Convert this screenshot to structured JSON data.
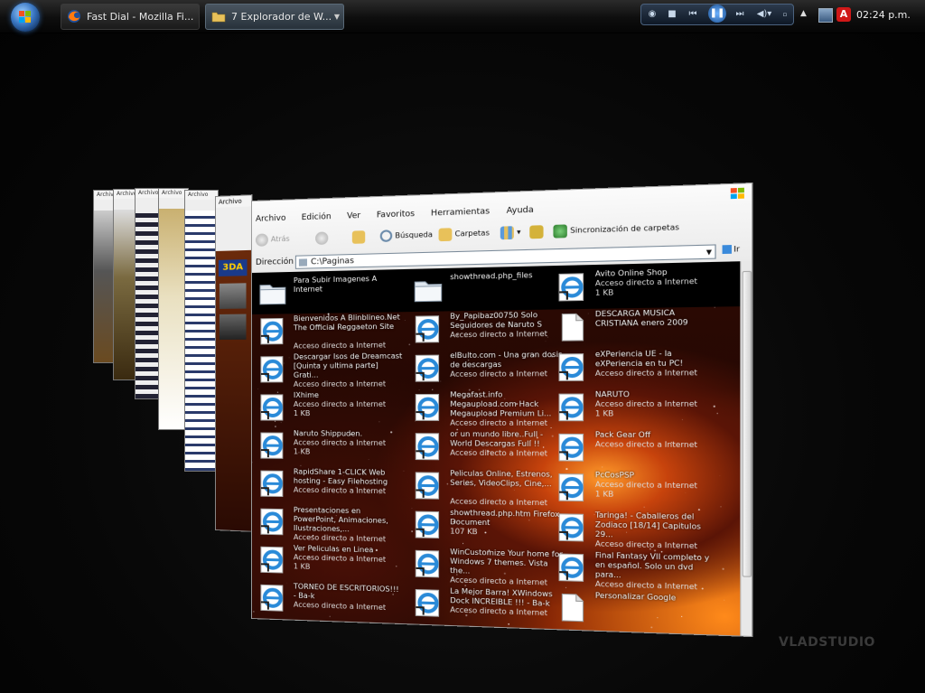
{
  "taskbar": {
    "tasks": [
      {
        "label": "Fast Dial - Mozilla Fi...",
        "icon": "firefox-icon"
      },
      {
        "label": "7  Explorador de W...",
        "icon": "folder-icon"
      }
    ],
    "clock": "02:24 p.m."
  },
  "explorer": {
    "menu": [
      "Archivo",
      "Edición",
      "Ver",
      "Favoritos",
      "Herramientas",
      "Ayuda"
    ],
    "toolbar": {
      "back": "Atrás",
      "search": "Búsqueda",
      "folders": "Carpetas",
      "sync": "Sincronización de carpetas"
    },
    "address_label": "Dirección",
    "address_value": "C:\\Paginas",
    "go_label": "Ir",
    "files": [
      {
        "name": "Para Subir Imagenes A Internet",
        "detail": "",
        "size": "",
        "icon": "folder"
      },
      {
        "name": "showthread.php_files",
        "detail": "",
        "size": "",
        "icon": "folder"
      },
      {
        "name": "Avito Online Shop",
        "detail": "Acceso directo a Internet",
        "size": "1 KB",
        "icon": "ie"
      },
      {
        "name": "Bienvenidos A Blinblineo.Net The Official Reggaeton Site",
        "detail": "Acceso directo a Internet",
        "size": "",
        "icon": "ie"
      },
      {
        "name": "By_Papibaz00750 Solo Seguidores de Naruto S",
        "detail": "Acceso directo a Internet",
        "size": "",
        "icon": "ie"
      },
      {
        "name": "DESCARGA MUSICA CRISTIANA enero 2009",
        "detail": "",
        "size": "",
        "icon": "doc"
      },
      {
        "name": "Descargar Isos de Dreamcast [Quinta y ultima parte] Grati...",
        "detail": "Acceso directo a Internet",
        "size": "",
        "icon": "ie"
      },
      {
        "name": "elBulto.com - Una gran dosis de descargas",
        "detail": "Acceso directo a Internet",
        "size": "",
        "icon": "ie"
      },
      {
        "name": "eXPeriencia UE - la eXPeriencia en tu PC!",
        "detail": "Acceso directo a Internet",
        "size": "",
        "icon": "ie"
      },
      {
        "name": "IXhime",
        "detail": "Acceso directo a Internet",
        "size": "1 KB",
        "icon": "ie"
      },
      {
        "name": "Megafast.info Megaupload.com Hack Megaupload Premium Li...",
        "detail": "Acceso directo a Internet",
        "size": "",
        "icon": "ie"
      },
      {
        "name": "NARUTO",
        "detail": "Acceso directo a Internet",
        "size": "1 KB",
        "icon": "ie"
      },
      {
        "name": "Naruto Shippuden.",
        "detail": "Acceso directo a Internet",
        "size": "1 KB",
        "icon": "ie"
      },
      {
        "name": "or un mundo libre..Full - World Descargas Full !!",
        "detail": "Acceso directo a Internet",
        "size": "",
        "icon": "ie"
      },
      {
        "name": "Pack Gear Off",
        "detail": "Acceso directo a Internet",
        "size": "",
        "icon": "ie"
      },
      {
        "name": "RapidShare 1-CLICK Web hosting - Easy Filehosting",
        "detail": "Acceso directo a Internet",
        "size": "",
        "icon": "ie"
      },
      {
        "name": "Peliculas Online, Estrenos, Series, VideoClips, Cine,...",
        "detail": "Acceso directo a Internet",
        "size": "",
        "icon": "ie"
      },
      {
        "name": "PcCosPSP",
        "detail": "Acceso directo a Internet",
        "size": "1 KB",
        "icon": "ie"
      },
      {
        "name": "Presentaciones en PowerPoint, Animaciones, Ilustraciones,...",
        "detail": "Acceso directo a Internet",
        "size": "",
        "icon": "ie"
      },
      {
        "name": "showthread.php.htm Firefox Document",
        "detail": "107 KB",
        "size": "",
        "icon": "ie"
      },
      {
        "name": "Taringa! - Caballeros del Zodiaco [18/14] Capitulos 29...",
        "detail": "Acceso directo a Internet",
        "size": "",
        "icon": "ie"
      },
      {
        "name": "Ver Peliculas en Linea",
        "detail": "Acceso directo a Internet",
        "size": "1 KB",
        "icon": "ie"
      },
      {
        "name": "WinCustomize Your home for Windows 7 themes. Vista the...",
        "detail": "Acceso directo a Internet",
        "size": "",
        "icon": "ie"
      },
      {
        "name": "Final Fantasy VII completo y en español. Solo un dvd para...",
        "detail": "Acceso directo a Internet",
        "size": "",
        "icon": "ie"
      },
      {
        "name": "TORNEO DE ESCRITORIOS!!! - Ba-k",
        "detail": "Acceso directo a Internet",
        "size": "",
        "icon": "ie"
      },
      {
        "name": "La Mejor Barra! XWindows Dock INCREIBLE !!! - Ba-k",
        "detail": "Acceso directo a Internet",
        "size": "",
        "icon": "ie"
      },
      {
        "name": "Personalizar Google",
        "detail": "",
        "size": "",
        "icon": "doc"
      }
    ]
  },
  "background_windows": [
    {
      "title": "Archivo"
    },
    {
      "title": "Archivo"
    },
    {
      "title": "Archivo"
    },
    {
      "title": "Archivo"
    },
    {
      "title": "Archivo"
    },
    {
      "title": "Archivo"
    }
  ],
  "sidebar_logo": "3DA",
  "watermark": "VLADSTUDIO",
  "colors": {
    "taskbar": "#0e0e0e",
    "accent": "#3b78c4",
    "nebula": "#ff9a2a"
  }
}
